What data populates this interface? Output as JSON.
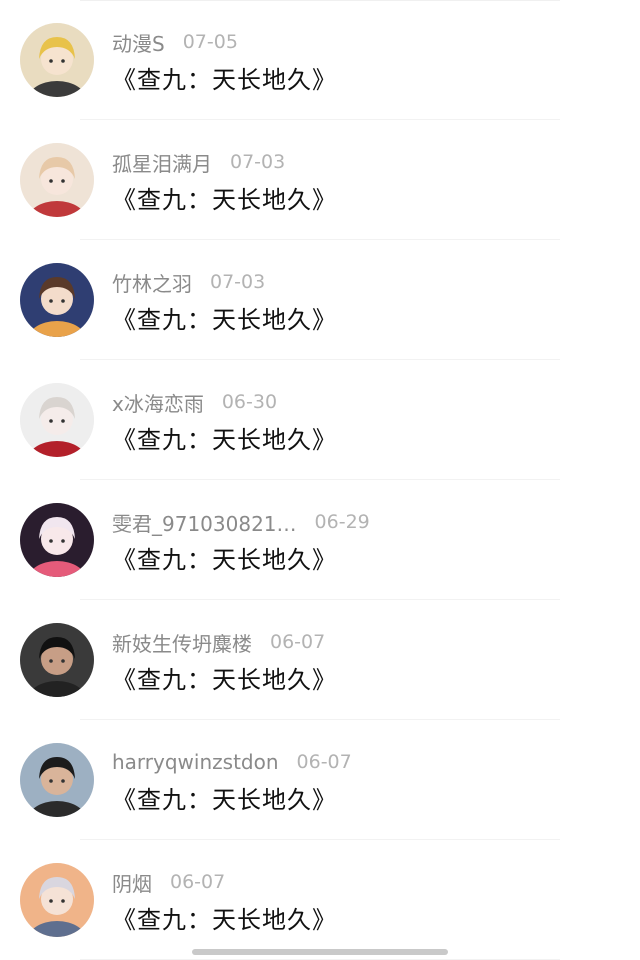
{
  "items": [
    {
      "username": "动漫S",
      "date": "07-05",
      "title": "《查九：天长地久》",
      "avatar": {
        "bg": "#e9dcc0",
        "hair": "#e8c24a",
        "skin": "#f6e3cf",
        "accent": "#3b3b3b"
      }
    },
    {
      "username": "孤星泪满月",
      "date": "07-03",
      "title": "《查九：天长地久》",
      "avatar": {
        "bg": "#efe3d6",
        "hair": "#e7c9a8",
        "skin": "#f7e6dc",
        "accent": "#c0393b"
      }
    },
    {
      "username": "竹林之羽",
      "date": "07-03",
      "title": "《查九：天长地久》",
      "avatar": {
        "bg": "#2f3e72",
        "hair": "#5a3a2a",
        "skin": "#f3dccb",
        "accent": "#e9a24a"
      }
    },
    {
      "username": "x冰海恋雨",
      "date": "06-30",
      "title": "《查九：天长地久》",
      "avatar": {
        "bg": "#eeeeee",
        "hair": "#d9d4d0",
        "skin": "#f5ecea",
        "accent": "#b3202a"
      }
    },
    {
      "username": "雯君_971030821…",
      "date": "06-29",
      "title": "《查九：天长地久》",
      "avatar": {
        "bg": "#2a1d2e",
        "hair": "#f1e6ef",
        "skin": "#f8e8ea",
        "accent": "#e55b7a"
      }
    },
    {
      "username": "新妓生传坍麋楼",
      "date": "06-07",
      "title": "《查九：天长地久》",
      "avatar": {
        "bg": "#3a3a3a",
        "hair": "#111111",
        "skin": "#c79e86",
        "accent": "#222222"
      }
    },
    {
      "username": "harryqwinzstdon",
      "date": "06-07",
      "title": "《查九：天长地久》",
      "avatar": {
        "bg": "#9db0c2",
        "hair": "#1c1c1c",
        "skin": "#d9b49a",
        "accent": "#2b2b2b"
      }
    },
    {
      "username": "阴烟",
      "date": "06-07",
      "title": "《查九：天长地久》",
      "avatar": {
        "bg": "#f0b489",
        "hair": "#d9d6df",
        "skin": "#f5e2d6",
        "accent": "#5f6f8f"
      }
    }
  ]
}
